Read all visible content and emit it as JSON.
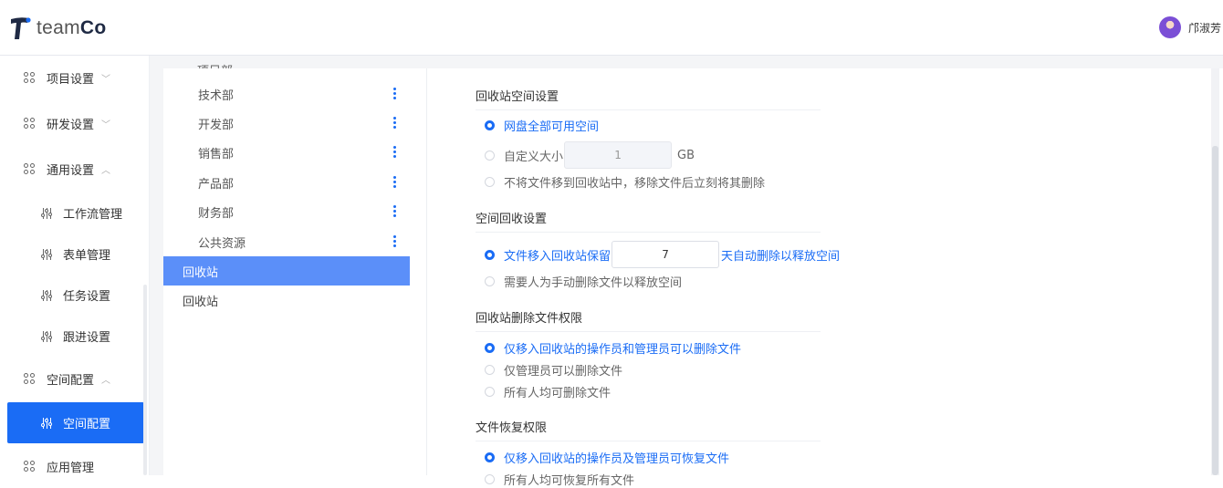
{
  "brand": {
    "logo_text_light": "team",
    "logo_text_bold": "Co",
    "accent": "#1a6cf5"
  },
  "user": {
    "name": "邝淑芳"
  },
  "sidebar": {
    "items": [
      {
        "label": "项目设置",
        "chevron": "﹀"
      },
      {
        "label": "研发设置",
        "chevron": "﹀"
      },
      {
        "label": "通用设置",
        "chevron": "︿"
      },
      {
        "label": "空间配置",
        "chevron": "︿"
      },
      {
        "label": "应用管理"
      }
    ],
    "subitems": [
      {
        "label": "工作流管理"
      },
      {
        "label": "表单管理"
      },
      {
        "label": "任务设置"
      },
      {
        "label": "跟进设置"
      },
      {
        "label": "空间配置"
      }
    ]
  },
  "departments": {
    "cut_label": "项目部",
    "list": [
      {
        "label": "技术部"
      },
      {
        "label": "开发部"
      },
      {
        "label": "销售部"
      },
      {
        "label": "产品部"
      },
      {
        "label": "财务部"
      },
      {
        "label": "公共资源"
      }
    ],
    "recycle_selected": "回收站",
    "recycle_plain": "回收站"
  },
  "settings": {
    "space": {
      "title": "回收站空间设置",
      "opt_all": "网盘全部可用空间",
      "opt_custom": "自定义大小",
      "custom_value": "1",
      "custom_unit": "GB",
      "opt_none": "不将文件移到回收站中，移除文件后立刻将其删除"
    },
    "reclaim": {
      "title": "空间回收设置",
      "opt_keep_prefix": "文件移入回收站保留",
      "keep_value": "7",
      "opt_keep_suffix": "天自动删除以释放空间",
      "opt_manual": "需要人为手动删除文件以释放空间"
    },
    "delete_perm": {
      "title": "回收站删除文件权限",
      "opt_mover_admin": "仅移入回收站的操作员和管理员可以删除文件",
      "opt_admin": "仅管理员可以删除文件",
      "opt_all": "所有人均可删除文件"
    },
    "restore_perm": {
      "title": "文件恢复权限",
      "opt_mover_admin": "仅移入回收站的操作员及管理员可恢复文件",
      "opt_next": "所有人均可恢复所有文件"
    }
  }
}
